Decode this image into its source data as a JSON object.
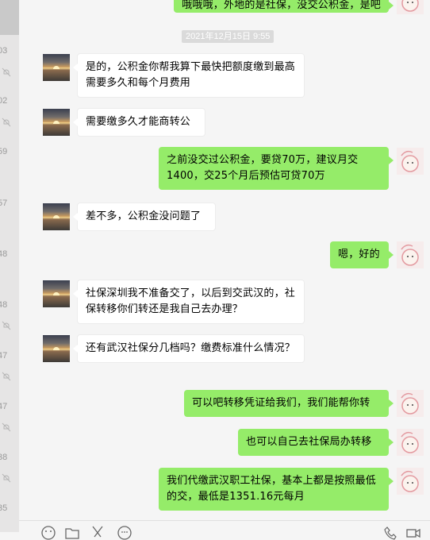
{
  "sidebar": {
    "times": [
      "03",
      "02",
      "59",
      "57",
      "48",
      "48",
      "47",
      "47",
      "38",
      "35"
    ]
  },
  "chat": {
    "timestamp": "2021年12月15日 9:55",
    "messages": [
      {
        "side": "out",
        "text": "哦哦哦，外地的是社保，没交公积金，是吧"
      },
      {
        "side": "in",
        "text": "是的，公积金你帮我算下最快把额度缴到最高需要多久和每个月费用"
      },
      {
        "side": "in",
        "text": "需要缴多久才能商转公"
      },
      {
        "side": "out",
        "text": "之前没交过公积金，要贷70万，建议月交1400，交25个月后预估可贷70万"
      },
      {
        "side": "in",
        "text": "差不多，公积金没问题了"
      },
      {
        "side": "out",
        "text": "嗯，好的"
      },
      {
        "side": "in",
        "text": "社保深圳我不准备交了，以后到交武汉的，社保转移你们转还是我自己去办理？"
      },
      {
        "side": "in",
        "text": "还有武汉社保分几档吗？缴费标准什么情况？"
      },
      {
        "side": "out",
        "text": "可以吧转移凭证给我们，我们能帮你转"
      },
      {
        "side": "out",
        "text": "也可以自己去社保局办转移"
      },
      {
        "side": "out",
        "text": "我们代缴武汉职工社保，基本上都是按照最低的交，最低是1351.16元每月"
      }
    ]
  },
  "toolbar": {
    "icons": [
      "emoji-icon",
      "folder-icon",
      "scissors-icon",
      "chat-bubble-icon",
      "phone-icon",
      "video-icon"
    ]
  }
}
